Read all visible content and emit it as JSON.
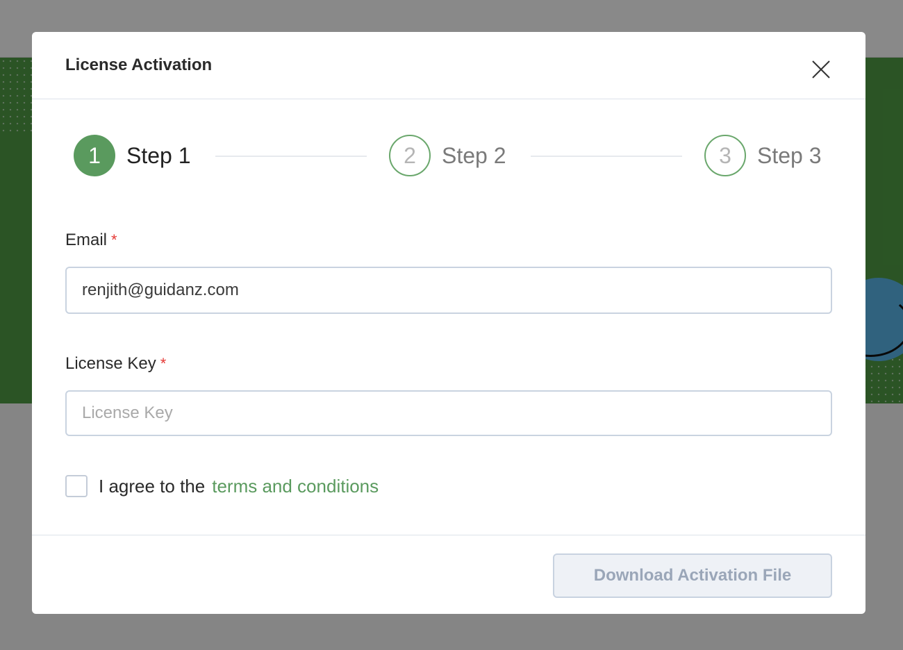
{
  "modal": {
    "title": "License Activation",
    "steps": [
      {
        "number": "1",
        "label": "Step 1",
        "state": "active"
      },
      {
        "number": "2",
        "label": "Step 2",
        "state": "pending"
      },
      {
        "number": "3",
        "label": "Step 3",
        "state": "pending"
      }
    ],
    "email": {
      "label": "Email",
      "required_mark": "*",
      "value": "renjith@guidanz.com"
    },
    "license_key": {
      "label": "License Key",
      "required_mark": "*",
      "placeholder": "License Key",
      "value": ""
    },
    "agreement": {
      "text": "I agree to the",
      "link_text": "terms and conditions",
      "checked": false
    },
    "footer": {
      "download_label": "Download Activation File",
      "download_enabled": false
    }
  },
  "colors": {
    "accent_green": "#5a9a5e",
    "required_red": "#e53935",
    "disabled_button_text": "#9aa6b8"
  },
  "icons": {
    "close": "close-icon"
  }
}
